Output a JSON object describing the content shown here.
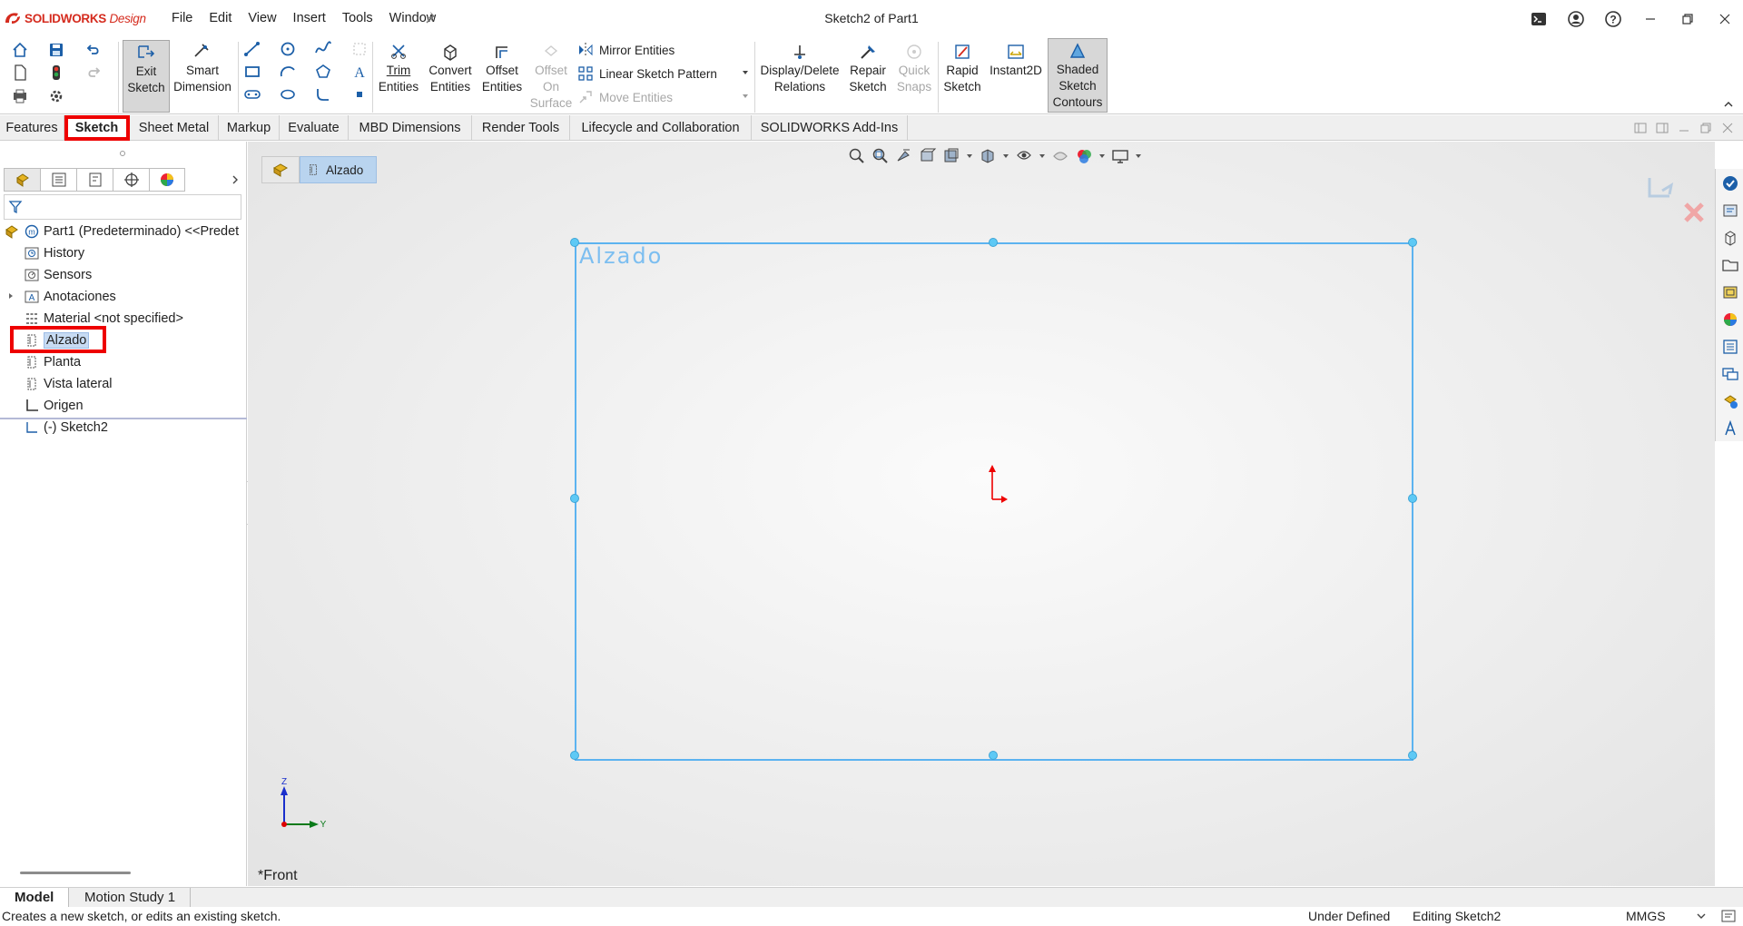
{
  "app": {
    "logo_brand": "SOLIDWORKS",
    "logo_suffix": "Design",
    "document_title": "Sketch2 of Part1"
  },
  "menu": [
    "File",
    "Edit",
    "View",
    "Insert",
    "Tools",
    "Window"
  ],
  "ribbon": {
    "exit_sketch": [
      "Exit",
      "Sketch"
    ],
    "smart_dimension": [
      "Smart",
      "Dimension"
    ],
    "trim_entities": [
      "Trim",
      "Entities"
    ],
    "convert_entities": [
      "Convert",
      "Entities"
    ],
    "offset_entities": [
      "Offset",
      "Entities"
    ],
    "offset_on_surface": [
      "Offset",
      "On",
      "Surface"
    ],
    "mirror_entities": "Mirror Entities",
    "linear_sketch_pattern": "Linear Sketch Pattern",
    "move_entities": "Move Entities",
    "display_delete_relations": [
      "Display/Delete",
      "Relations"
    ],
    "repair_sketch": [
      "Repair",
      "Sketch"
    ],
    "quick_snaps": [
      "Quick",
      "Snaps"
    ],
    "rapid_sketch": [
      "Rapid",
      "Sketch"
    ],
    "instant2d": "Instant2D",
    "shaded_sketch_contours": [
      "Shaded",
      "Sketch",
      "Contours"
    ]
  },
  "tabs": [
    "Features",
    "Sketch",
    "Sheet Metal",
    "Markup",
    "Evaluate",
    "MBD Dimensions",
    "Render Tools",
    "Lifecycle and Collaboration",
    "SOLIDWORKS Add-Ins"
  ],
  "active_tab": "Sketch",
  "tree": {
    "root": "Part1 (Predeterminado) <<Predet",
    "items": [
      "History",
      "Sensors",
      "Anotaciones",
      "Material <not specified>",
      "Alzado",
      "Planta",
      "Vista lateral",
      "Origen",
      "(-) Sketch2"
    ]
  },
  "viewport": {
    "breadcrumb": "Alzado",
    "plane_label": "Alzado",
    "view_name": "*Front",
    "triad_z": "Z",
    "triad_y": "Y"
  },
  "bottom_tabs": [
    "Model",
    "Motion Study 1"
  ],
  "status": {
    "message": "Creates a new sketch, or edits an existing sketch.",
    "state": "Under Defined",
    "mode": "Editing Sketch2",
    "units": "MMGS"
  },
  "colors": {
    "accent_red": "#e00000",
    "sketch_blue": "#5cb3f0",
    "selection_blue": "#b9d4ef"
  }
}
